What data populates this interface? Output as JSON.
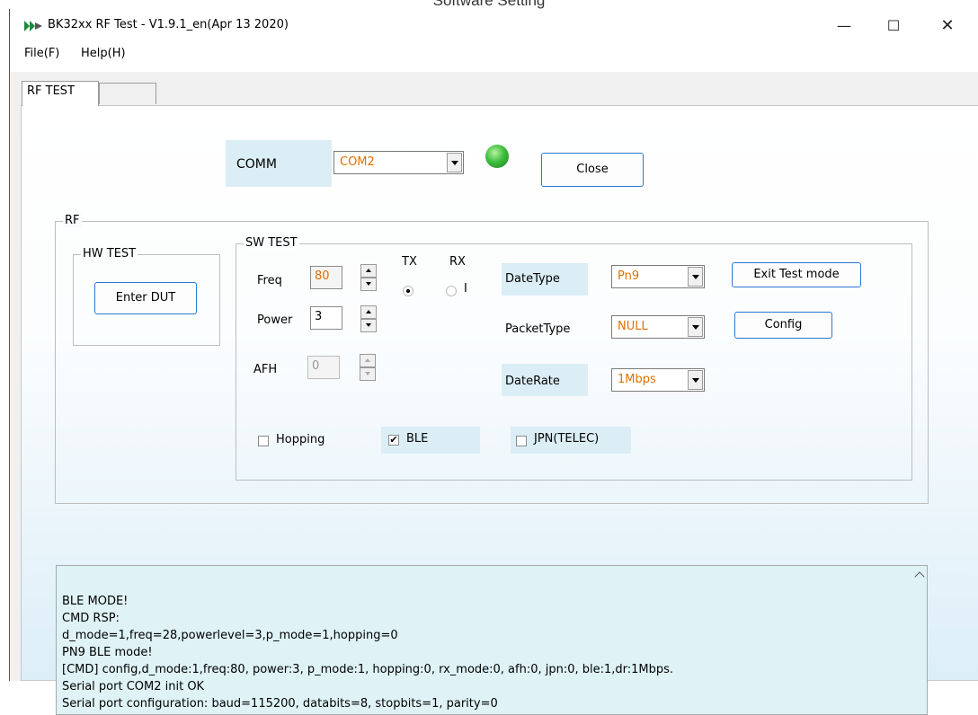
{
  "page": {
    "cut_title": "Software Setting"
  },
  "window": {
    "title": "BK32xx RF Test - V1.9.1_en(Apr 13 2020)",
    "controls": {
      "minimize": "—",
      "maximize": "☐",
      "close": "✕"
    }
  },
  "menu": {
    "file": "File(F)",
    "help": "Help(H)"
  },
  "tabs": {
    "rf_test": "RF TEST",
    "blank": ""
  },
  "comm": {
    "label": "COMM",
    "port": "COM2",
    "close_button": "Close",
    "led_color": "#3fbf3f"
  },
  "rf": {
    "group_title": "RF",
    "hw_test": {
      "title": "HW TEST",
      "enter_dut": "Enter DUT"
    },
    "sw_test": {
      "title": "SW TEST",
      "freq_label": "Freq",
      "freq_value": "80",
      "power_label": "Power",
      "power_value": "3",
      "afh_label": "AFH",
      "afh_value": "0",
      "tx_label": "TX",
      "rx_label": "RX",
      "rx_radio_text": "I",
      "date_type_label": "DateType",
      "date_type_value": "Pn9",
      "packet_type_label": "PacketType",
      "packet_type_value": "NULL",
      "date_rate_label": "DateRate",
      "date_rate_value": "1Mbps",
      "exit_test_mode": "Exit Test mode",
      "config": "Config",
      "hopping_label": "Hopping",
      "hopping_checked": false,
      "ble_label": "BLE",
      "ble_checked": true,
      "jpn_label": "JPN(TELEC)",
      "jpn_checked": false
    }
  },
  "log": {
    "lines": [
      "BLE MODE!",
      "CMD RSP:",
      "d_mode=1,freq=28,powerlevel=3,p_mode=1,hopping=0",
      "PN9 BLE mode!",
      "[CMD] config,d_mode:1,freq:80, power:3, p_mode:1, hopping:0, rx_mode:0, afh:0, jpn:0, ble:1,dr:1Mbps.",
      "Serial port COM2 init OK",
      "Serial port configuration: baud=115200, databits=8, stopbits=1, parity=0"
    ]
  }
}
